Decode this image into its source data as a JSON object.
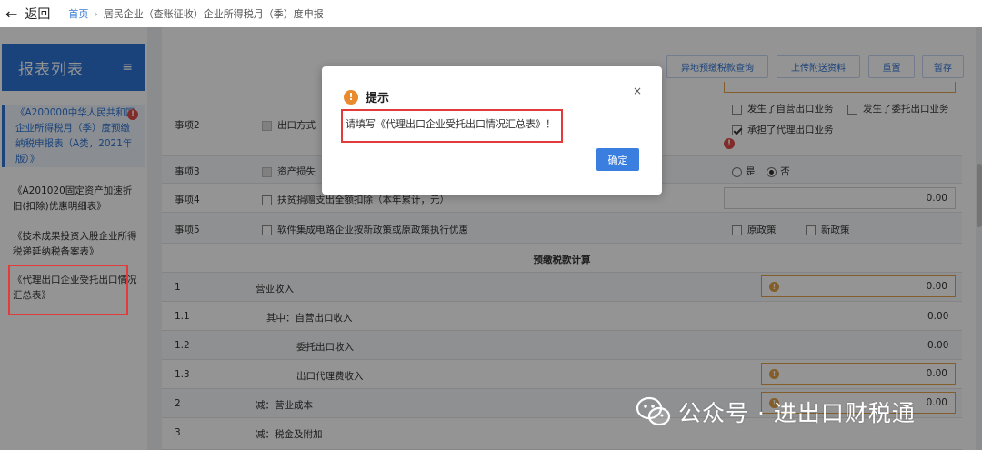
{
  "topbar": {
    "back_label": "返回",
    "breadcrumb_home": "首页",
    "breadcrumb_current": "居民企业（查账征收）企业所得税月（季）度申报"
  },
  "sidebar": {
    "title": "报表列表",
    "items": [
      {
        "label": "《A200000中华人民共和国企业所得税月（季）度预缴纳税申报表（A类，2021年版）》",
        "badge": "!"
      },
      {
        "label": "《A201020固定资产加速折旧(扣除)优惠明细表》"
      },
      {
        "label": "《技术成果投资入股企业所得税递延纳税备案表》"
      },
      {
        "label": "《代理出口企业受托出口情况汇总表》"
      }
    ]
  },
  "toolbar": {
    "btn_remote_query": "异地预缴税款查询",
    "btn_upload": "上传附送资料",
    "btn_reset": "重置",
    "btn_save": "暂存"
  },
  "form": {
    "item2": {
      "label": "事项2",
      "field": "出口方式",
      "opt_self": "发生了自营出口业务",
      "opt_entrust": "发生了委托出口业务",
      "opt_agent": "承担了代理出口业务"
    },
    "item3": {
      "label": "事项3",
      "field": "资产损失",
      "yes": "是",
      "no": "否"
    },
    "item4": {
      "label": "事项4",
      "field": "扶贫捐赠支出全额扣除（本年累计，元）",
      "value": "0.00"
    },
    "item5": {
      "label": "事项5",
      "field": "软件集成电路企业按新政策或原政策执行优惠",
      "old": "原政策",
      "new": "新政策"
    },
    "section_title": "预缴税款计算",
    "rows": [
      {
        "no": "1",
        "name": "营业收入",
        "value": "0.00"
      },
      {
        "no": "1.1",
        "name": "其中：自营出口收入",
        "value": "0.00"
      },
      {
        "no": "1.2",
        "name": "委托出口收入",
        "value": "0.00"
      },
      {
        "no": "1.3",
        "name": "出口代理费收入",
        "value": "0.00"
      },
      {
        "no": "2",
        "name": "减：营业成本",
        "value": "0.00"
      },
      {
        "no": "3",
        "name": "减：税金及附加",
        "value": ""
      }
    ]
  },
  "modal": {
    "title": "提示",
    "close": "×",
    "message": "请填写《代理出口企业受托出口情况汇总表》！",
    "ok_label": "确定"
  },
  "watermark": {
    "text": "公众号 · 进出口财税通"
  },
  "colors": {
    "primary": "#2d74d4",
    "warning": "#e98a2c",
    "error": "#e23b3b"
  }
}
